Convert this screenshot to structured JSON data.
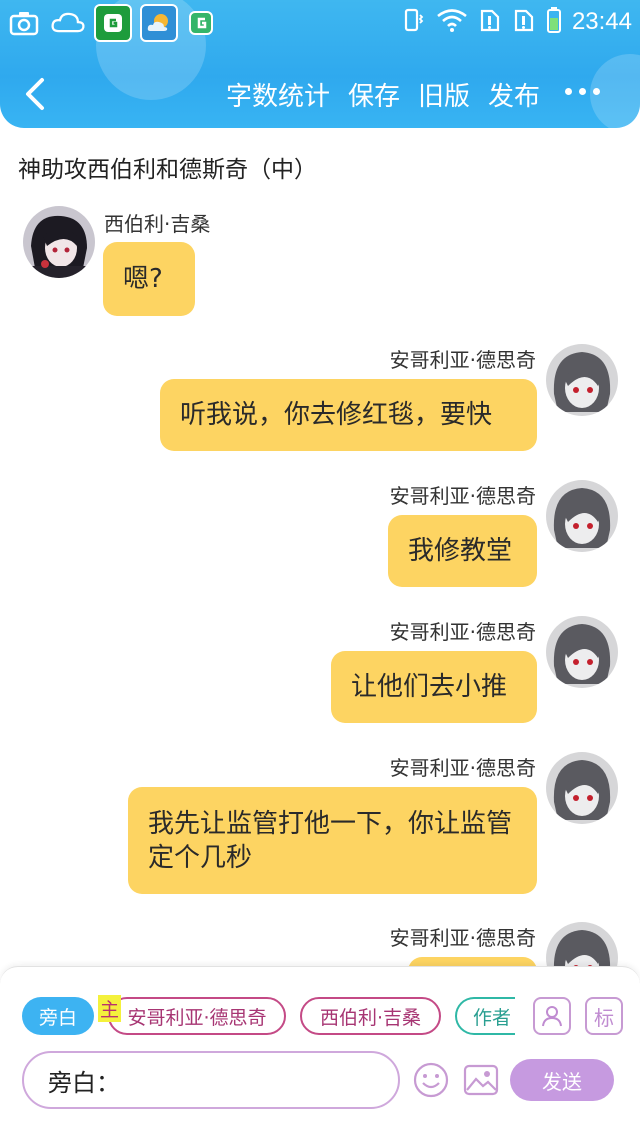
{
  "status_bar": {
    "time": "23:44"
  },
  "nav": {
    "actions": [
      "字数统计",
      "保存",
      "旧版",
      "发布"
    ]
  },
  "story": {
    "title": "神助攻西伯利和德斯奇（中）"
  },
  "messages": [
    {
      "side": "left",
      "speaker": "西伯利·吉桑",
      "text": "嗯?"
    },
    {
      "side": "right",
      "speaker": "安哥利亚·德思奇",
      "text": "听我说，你去修红毯，要快"
    },
    {
      "side": "right",
      "speaker": "安哥利亚·德思奇",
      "text": "我修教堂"
    },
    {
      "side": "right",
      "speaker": "安哥利亚·德思奇",
      "text": "让他们去小推"
    },
    {
      "side": "right",
      "speaker": "安哥利亚·德思奇",
      "text": "我先让监管打他一下，你让监管定个几秒"
    },
    {
      "side": "right",
      "speaker": "安哥利亚·德思奇",
      "text": ""
    }
  ],
  "composer": {
    "chips": {
      "narration": "旁白",
      "main_mark": "主",
      "role_a": "安哥利亚·德思奇",
      "role_b": "西伯利·吉桑",
      "author": "作者"
    },
    "tag_button": "标",
    "input_value": "旁白：",
    "send_label": "发送"
  },
  "colors": {
    "header": "#2fa9ee",
    "bubble": "#fdd462",
    "send": "#c69ae0",
    "narration_chip": "#3db3f2"
  }
}
